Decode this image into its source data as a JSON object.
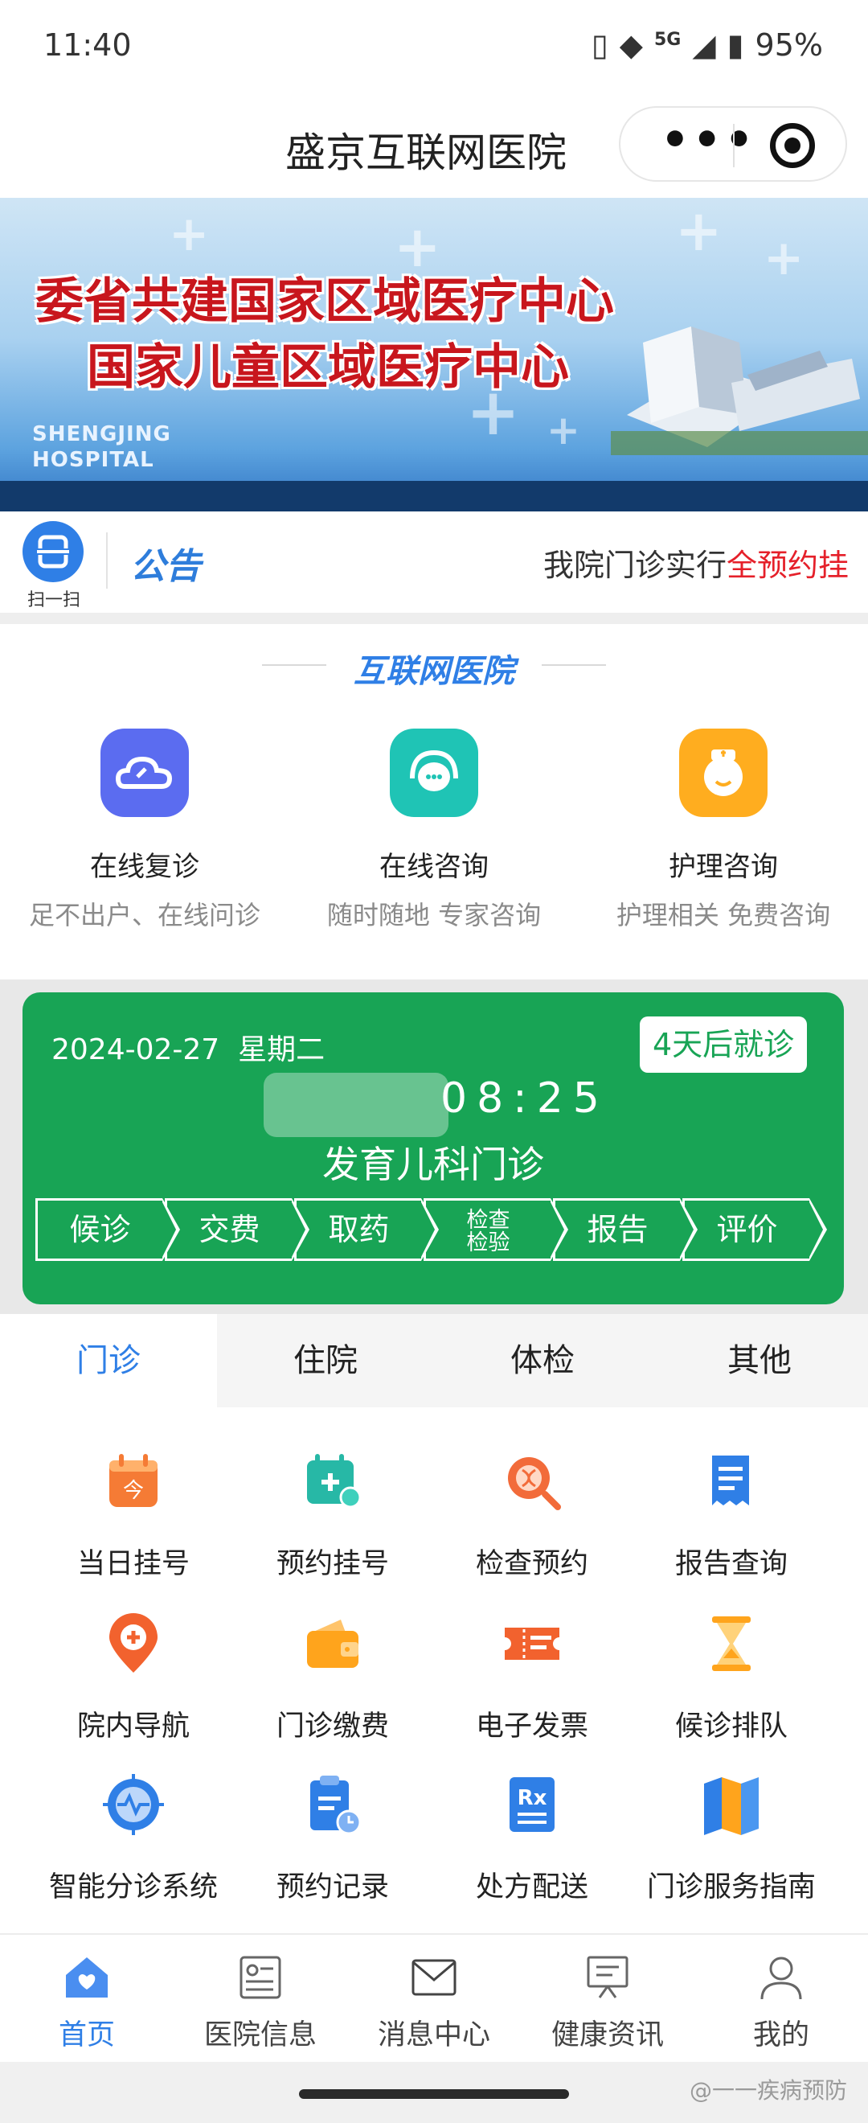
{
  "status_bar": {
    "time": "11:40",
    "network": "5G",
    "battery": "95%"
  },
  "header": {
    "title": "盛京互联网医院",
    "more_icon": "more-dots-icon",
    "close_icon": "target-icon"
  },
  "banner": {
    "line1": "委省共建国家区域医疗中心",
    "line2": "国家儿童区域医疗中心",
    "brand_line1": "SHENGJING",
    "brand_line2": "HOSPITAL"
  },
  "notice": {
    "scan_label": "扫一扫",
    "tag": "公告",
    "text_plain": "我院门诊实行",
    "text_highlight": "全预约挂"
  },
  "internet_hospital": {
    "title": "互联网医院",
    "items": [
      {
        "name": "在线复诊",
        "desc": "足不出户、在线问诊",
        "icon": "cloud-icon",
        "color": "#5b6cf0"
      },
      {
        "name": "在线咨询",
        "desc": "随时随地 专家咨询",
        "icon": "headset-icon",
        "color": "#1fc4b5"
      },
      {
        "name": "护理咨询",
        "desc": "护理相关 免费咨询",
        "icon": "nurse-icon",
        "color": "#ffad1f"
      }
    ]
  },
  "appointment": {
    "date": "2024-02-27",
    "weekday": "星期二",
    "countdown": "4天后就诊",
    "time": "08:25",
    "department": "发育儿科门诊",
    "steps": [
      "候诊",
      "交费",
      "取药",
      "检查",
      "报告",
      "评价"
    ],
    "step4_line2": "检验"
  },
  "tabs": [
    "门诊",
    "住院",
    "体检",
    "其他"
  ],
  "services": [
    {
      "label": "当日挂号",
      "icon": "calendar-today-icon",
      "color": "#f57b35"
    },
    {
      "label": "预约挂号",
      "icon": "calendar-plus-icon",
      "color": "#27b8a6"
    },
    {
      "label": "检查预约",
      "icon": "dna-search-icon",
      "color": "#f26b3a"
    },
    {
      "label": "报告查询",
      "icon": "report-icon",
      "color": "#2f7fe6"
    },
    {
      "label": "院内导航",
      "icon": "location-pin-icon",
      "color": "#f2622e"
    },
    {
      "label": "门诊缴费",
      "icon": "wallet-icon",
      "color": "#ffa41c"
    },
    {
      "label": "电子发票",
      "icon": "ticket-icon",
      "color": "#f2622e"
    },
    {
      "label": "候诊排队",
      "icon": "hourglass-icon",
      "color": "#ffa41c"
    },
    {
      "label": "智能分诊系统",
      "icon": "pulse-target-icon",
      "color": "#2f7fe6"
    },
    {
      "label": "预约记录",
      "icon": "clipboard-clock-icon",
      "color": "#2f7fe6"
    },
    {
      "label": "处方配送",
      "icon": "rx-icon",
      "color": "#2f7fe6"
    },
    {
      "label": "门诊服务指南",
      "icon": "map-guide-icon",
      "color": "#2f7fe6"
    }
  ],
  "bottom_nav": [
    {
      "label": "首页",
      "icon": "home-heart-icon"
    },
    {
      "label": "医院信息",
      "icon": "hospital-info-icon"
    },
    {
      "label": "消息中心",
      "icon": "mail-icon"
    },
    {
      "label": "健康资讯",
      "icon": "news-board-icon"
    },
    {
      "label": "我的",
      "icon": "user-icon"
    }
  ],
  "watermark": "@一一疾病预防"
}
